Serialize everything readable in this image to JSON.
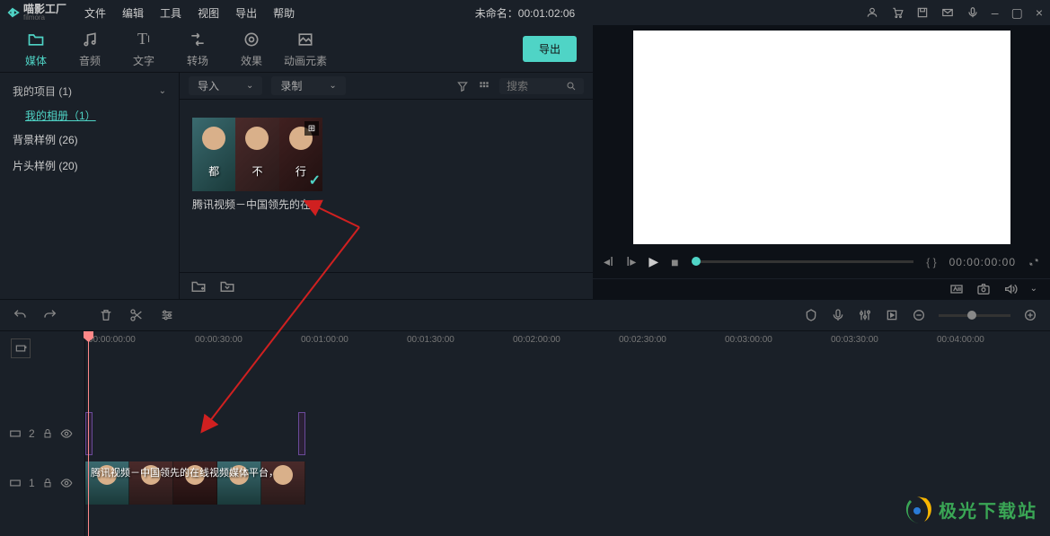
{
  "app": {
    "brand": "喵影工厂",
    "sub_brand": "filmora"
  },
  "menu": [
    "文件",
    "编辑",
    "工具",
    "视图",
    "导出",
    "帮助"
  ],
  "titlebar_center": "未命名：00:01:02:06",
  "window_ctrl": {
    "minimize": "–",
    "maximize": "▢",
    "close": "×"
  },
  "tabs": {
    "items": [
      {
        "name": "media",
        "label": "媒体",
        "icon": "📁"
      },
      {
        "name": "audio",
        "label": "音频",
        "icon": "♫"
      },
      {
        "name": "text",
        "label": "文字",
        "icon": "T"
      },
      {
        "name": "transition",
        "label": "转场",
        "icon": "⇄"
      },
      {
        "name": "effect",
        "label": "效果",
        "icon": "✦"
      },
      {
        "name": "element",
        "label": "动画元素",
        "icon": "🖼"
      }
    ],
    "export": "导出"
  },
  "sidebar": {
    "items": [
      {
        "label": "我的项目 (1)",
        "expandable": true
      },
      {
        "label": "我的相册（1）",
        "sub": true
      },
      {
        "label": "背景样例 (26)"
      },
      {
        "label": "片头样例 (20)"
      }
    ]
  },
  "media_toolbar": {
    "import": "导入",
    "record": "录制",
    "search_placeholder": "搜索"
  },
  "clip": {
    "name": "腾讯视频－中国领先的在",
    "overlay_chars": [
      "都",
      "不",
      "行"
    ]
  },
  "preview": {
    "timecode": "00:00:00:00",
    "brackets": "{  }"
  },
  "timeline": {
    "marks": [
      "00:00:00:00",
      "00:00:30:00",
      "00:01:00:00",
      "00:01:30:00",
      "00:02:00:00",
      "00:02:30:00",
      "00:03:00:00",
      "00:03:30:00",
      "00:04:00:00"
    ],
    "track2": "2",
    "track1": "1",
    "clip_label": "腾讯视频－中国领先的在线视频媒体平台，"
  },
  "watermark": {
    "text": "极光下载站"
  }
}
